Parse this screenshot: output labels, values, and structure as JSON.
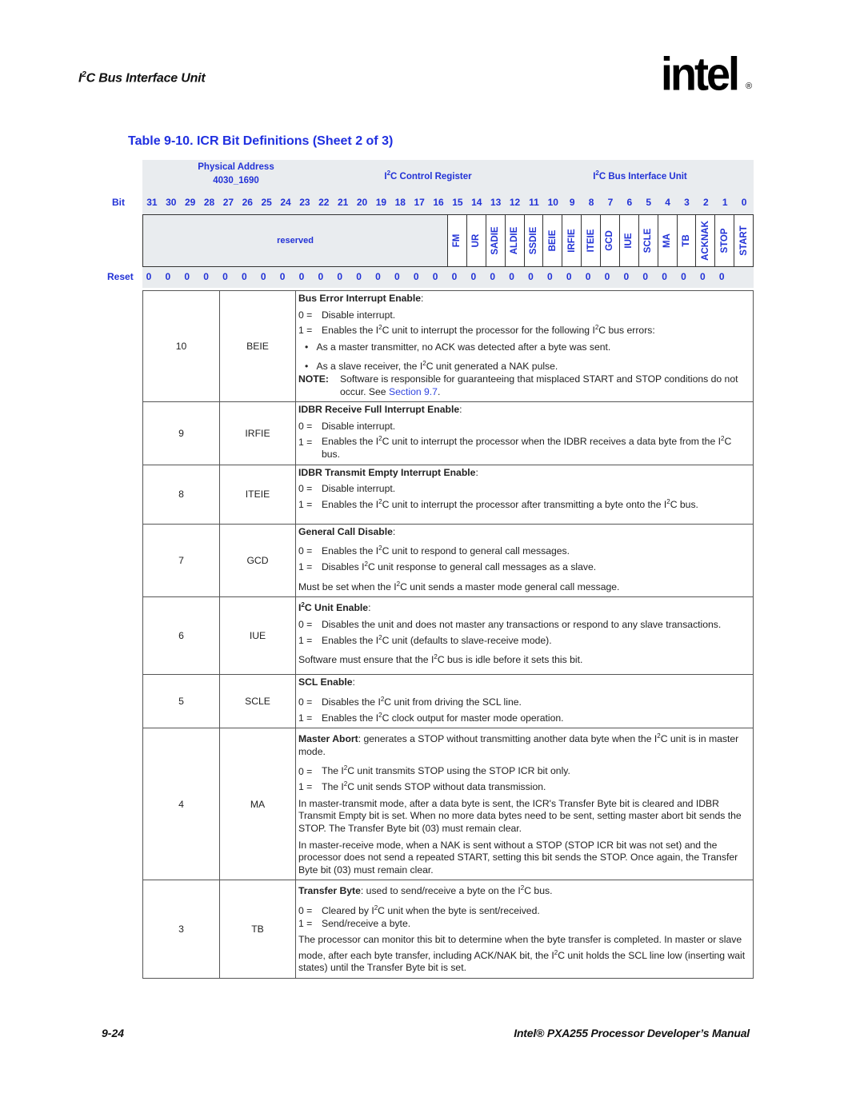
{
  "running_head": {
    "prefix": "I",
    "sup": "2",
    "suffix": "C Bus Interface Unit"
  },
  "logo": {
    "text": "intel",
    "registered": "®"
  },
  "table_title": "Table 9-10.  ICR Bit Definitions (Sheet 2 of 3)",
  "register": {
    "physical_address_label": "Physical Address",
    "physical_address": "4030_1690",
    "name_prefix": "I",
    "name_sup": "2",
    "name_suffix": "C Control Register",
    "unit_prefix": "I",
    "unit_sup": "2",
    "unit_suffix": "C Bus Interface Unit",
    "bit_label": "Bit",
    "reset_label": "Reset",
    "bits": [
      "31",
      "30",
      "29",
      "28",
      "27",
      "26",
      "25",
      "24",
      "23",
      "22",
      "21",
      "20",
      "19",
      "18",
      "17",
      "16",
      "15",
      "14",
      "13",
      "12",
      "11",
      "10",
      "9",
      "8",
      "7",
      "6",
      "5",
      "4",
      "3",
      "2",
      "1",
      "0"
    ],
    "reserved_label": "reserved",
    "fields": [
      "FM",
      "UR",
      "SADIE",
      "ALDIE",
      "SSDIE",
      "BEIE",
      "IRFIE",
      "ITEIE",
      "GCD",
      "IUE",
      "SCLE",
      "MA",
      "TB",
      "ACKNAK",
      "STOP",
      "START"
    ],
    "reset_values": [
      "0",
      "0",
      "0",
      "0",
      "0",
      "0",
      "0",
      "0",
      "0",
      "0",
      "0",
      "0",
      "0",
      "0",
      "0",
      "0",
      "0",
      "0",
      "0",
      "0",
      "0",
      "0",
      "0",
      "0",
      "0",
      "0",
      "0",
      "0",
      "0",
      "0",
      "0",
      ""
    ]
  },
  "rows": [
    {
      "bit": "10",
      "name": "BEIE",
      "title": "Bus Error Interrupt Enable",
      "v0": "Disable interrupt.",
      "v1a": "Enables the I",
      "v1b": "C unit to interrupt the processor for the following I",
      "v1c": "C bus errors:",
      "bullet1": "As a master transmitter, no ACK was detected after a byte was sent.",
      "bullet2a": "As a slave receiver, the I",
      "bullet2b": "C unit generated a NAK pulse.",
      "note_label": "NOTE:",
      "note_text": "Software is responsible for guaranteeing that misplaced START and STOP conditions do not occur. See ",
      "note_link": "Section 9.7",
      "note_end": "."
    },
    {
      "bit": "9",
      "name": "IRFIE",
      "title": "IDBR Receive Full Interrupt Enable",
      "v0": "Disable interrupt.",
      "v1a": "Enables the I",
      "v1b": "C unit to interrupt the processor when the IDBR receives a data byte from the I",
      "v1c": "C bus."
    },
    {
      "bit": "8",
      "name": "ITEIE",
      "title": "IDBR Transmit Empty Interrupt Enable",
      "v0": "Disable interrupt.",
      "v1a": "Enables the I",
      "v1b": "C unit to interrupt the processor after transmitting a byte onto the I",
      "v1c": "C bus."
    },
    {
      "bit": "7",
      "name": "GCD",
      "title": "General Call Disable",
      "v0a": "Enables the I",
      "v0b": "C unit to respond to general call messages.",
      "v1a": "Disables I",
      "v1b": "C unit response to general call messages as a slave.",
      "extra_a": "Must be set when the I",
      "extra_b": "C unit sends a master mode general call message."
    },
    {
      "bit": "6",
      "name": "IUE",
      "title_a": "I",
      "title_b": "C Unit Enable",
      "v0": "Disables the unit and does not master any transactions or respond to any slave transactions.",
      "v1a": "Enables the I",
      "v1b": "C unit (defaults to slave-receive mode).",
      "extra_a": "Software must ensure that the I",
      "extra_b": "C bus is idle before it sets this bit."
    },
    {
      "bit": "5",
      "name": "SCLE",
      "title": "SCL Enable",
      "v0a": "Disables the I",
      "v0b": "C unit from driving the SCL line.",
      "v1a": "Enables the I",
      "v1b": "C clock output for master mode operation."
    },
    {
      "bit": "4",
      "name": "MA",
      "title": "Master Abort",
      "title_rest_a": ": generates a STOP without transmitting another data byte when the I",
      "title_rest_b": "C unit is in master mode.",
      "v0a": "The I",
      "v0b": "C unit transmits STOP using the STOP ICR bit only.",
      "v1a": "The I",
      "v1b": "C unit sends STOP without data transmission.",
      "para1": "In master-transmit mode, after a data byte is sent, the ICR's Transfer Byte bit is cleared and IDBR Transmit Empty bit is set. When no more data bytes need to be sent, setting master abort bit sends the STOP. The Transfer Byte bit (03) must remain clear.",
      "para2": "In master-receive mode, when a NAK is sent without a STOP (STOP ICR bit was not set) and the processor does not send a repeated START, setting this bit sends the STOP. Once again, the Transfer Byte bit (03) must remain clear."
    },
    {
      "bit": "3",
      "name": "TB",
      "title": "Transfer Byte",
      "title_rest_a": ": used to send/receive a byte on the I",
      "title_rest_b": "C bus.",
      "v0a": "Cleared by I",
      "v0b": "C unit when the byte is sent/received.",
      "v1": "Send/receive a byte.",
      "para1a": "The processor can monitor this bit to determine when the byte transfer is completed. In master or slave mode, after each byte transfer, including ACK/NAK bit, the I",
      "para1b": "C unit holds the SCL line low (inserting wait states) until the Transfer Byte bit is set."
    }
  ],
  "sup2": "2",
  "key0": "0 =",
  "key1": "1 =",
  "bullet": "•",
  "colon": ":",
  "footer": {
    "page_number": "9-24",
    "manual_title": "Intel® PXA255 Processor Developer’s Manual"
  }
}
